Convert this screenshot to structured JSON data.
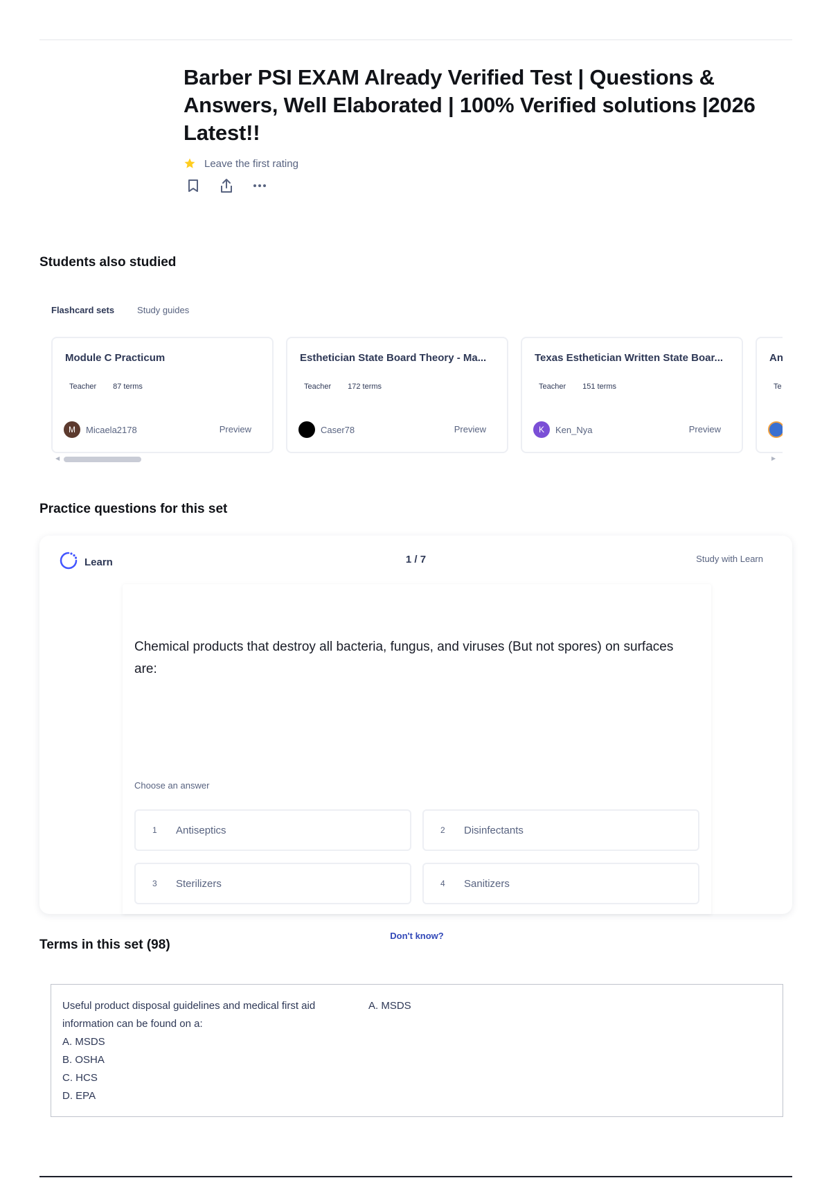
{
  "title": "Barber PSI EXAM Already Verified Test | Questions & Answers, Well Elaborated | 100% Verified solutions |2026 Latest!!",
  "rating": {
    "icon": "star-icon",
    "text": "Leave the first rating",
    "star_color": "#ffcd1f"
  },
  "actions": [
    "bookmark-icon",
    "share-icon",
    "more-icon"
  ],
  "students_also_studied": {
    "heading": "Students also studied",
    "tabs": [
      {
        "label": "Flashcard sets",
        "active": true
      },
      {
        "label": "Study guides",
        "active": false
      }
    ],
    "cards": [
      {
        "title": "Module C Practicum",
        "role": "Teacher",
        "terms": "87 terms",
        "author": "Micaela2178",
        "avatar_letter": "M",
        "avatar_color": "#5c3a2e",
        "preview": "Preview"
      },
      {
        "title": "Esthetician State Board Theory - Ma...",
        "role": "Teacher",
        "terms": "172 terms",
        "author": "Caser78",
        "avatar_letter": "",
        "avatar_color": "#000000",
        "preview": "Preview"
      },
      {
        "title": "Texas Esthetician Written State Boar...",
        "role": "Teacher",
        "terms": "151 terms",
        "author": "Ken_Nya",
        "avatar_letter": "K",
        "avatar_color": "#7b4fd6",
        "preview": "Preview"
      },
      {
        "title": "An",
        "role": "Te",
        "terms": "",
        "author": "",
        "avatar_letter": "",
        "avatar_color": "#3a6fd0",
        "preview": ""
      }
    ]
  },
  "practice": {
    "heading": "Practice questions for this set",
    "mode_label": "Learn",
    "progress": "1 / 7",
    "study_link": "Study with Learn",
    "question": "Chemical products that destroy all bacteria, fungus, and viruses (But not spores) on surfaces are:",
    "choose_label": "Choose an answer",
    "options": [
      {
        "num": "1",
        "text": "Antiseptics"
      },
      {
        "num": "2",
        "text": "Disinfectants"
      },
      {
        "num": "3",
        "text": "Sterilizers"
      },
      {
        "num": "4",
        "text": "Sanitizers"
      }
    ],
    "dont_know": "Don't know?"
  },
  "terms": {
    "heading": "Terms in this set (98)",
    "items": [
      {
        "term": "Useful product disposal guidelines and medical first aid information can be found on a:\nA. MSDS\nB. OSHA\nC. HCS\nD. EPA",
        "definition": "A. MSDS"
      }
    ]
  },
  "accent_color": "#3148b8"
}
